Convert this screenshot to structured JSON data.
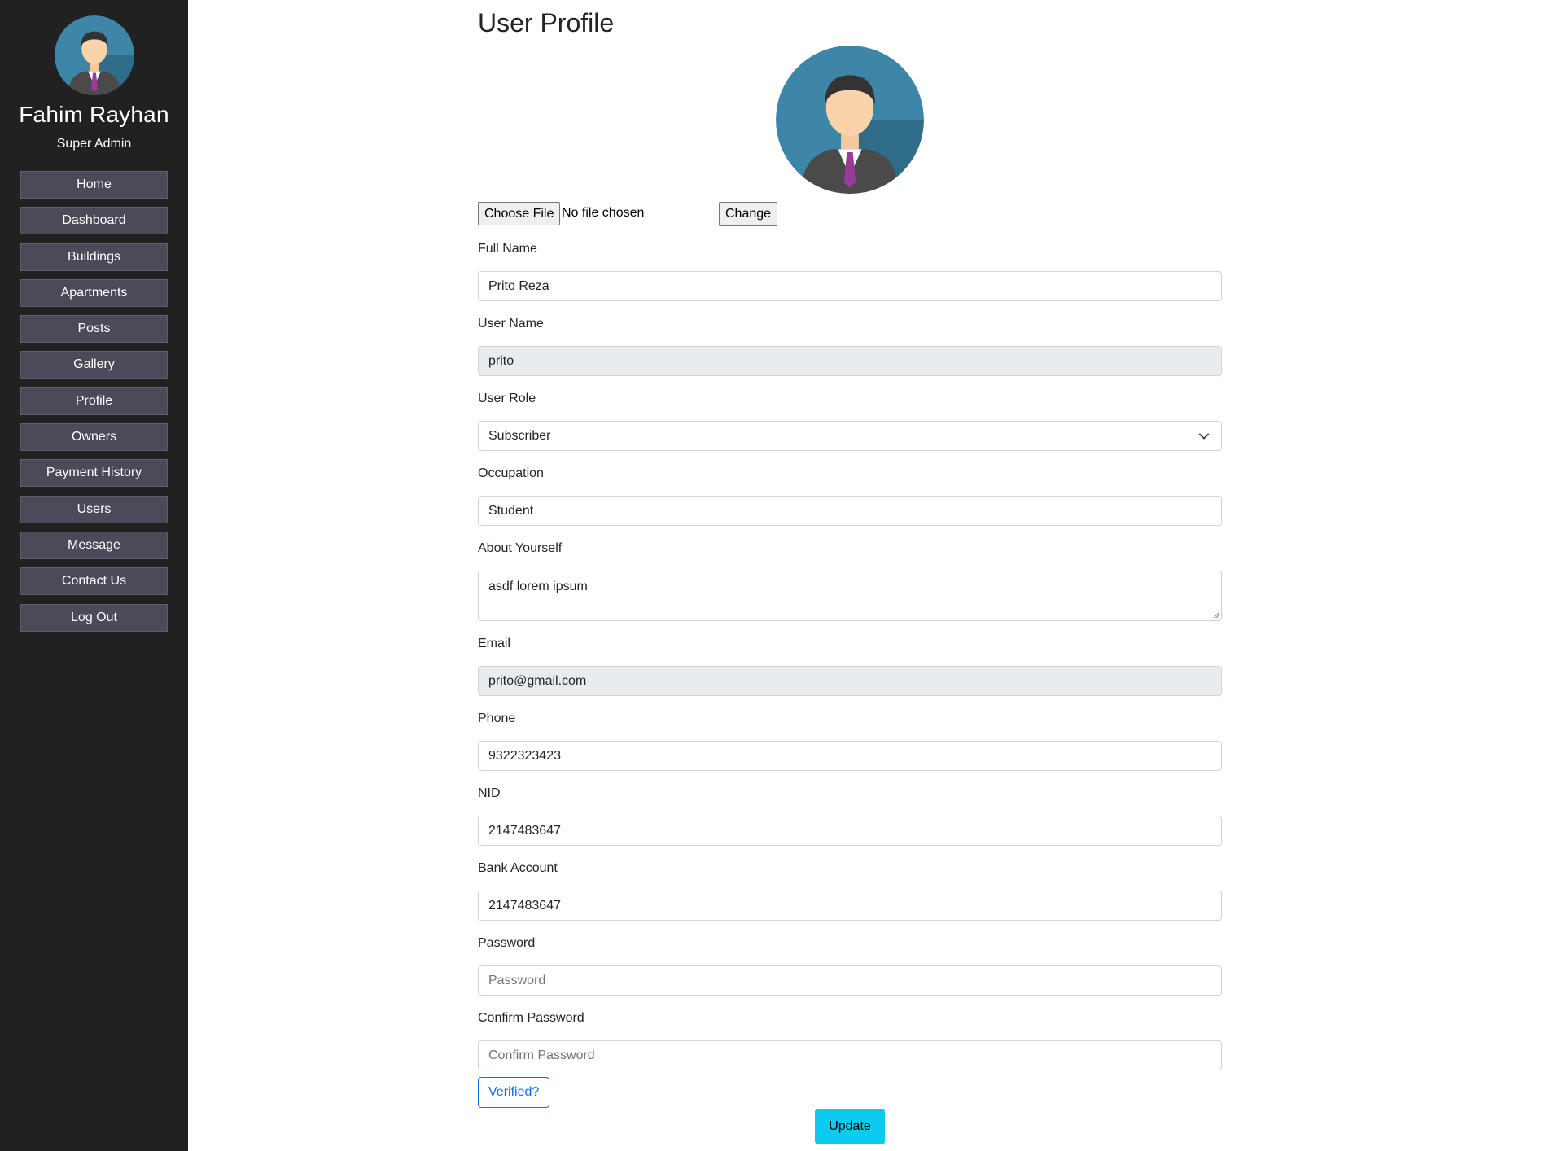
{
  "sidebar": {
    "user_name": "Fahim Rayhan",
    "user_role": "Super Admin",
    "items": [
      {
        "label": "Home"
      },
      {
        "label": "Dashboard"
      },
      {
        "label": "Buildings"
      },
      {
        "label": "Apartments"
      },
      {
        "label": "Posts"
      },
      {
        "label": "Gallery"
      },
      {
        "label": "Profile"
      },
      {
        "label": "Owners"
      },
      {
        "label": "Payment History"
      },
      {
        "label": "Users"
      },
      {
        "label": "Message"
      },
      {
        "label": "Contact Us"
      },
      {
        "label": "Log Out"
      }
    ]
  },
  "main": {
    "title": "User Profile",
    "file": {
      "choose_label": "Choose File",
      "status": "No file chosen",
      "change_label": "Change"
    },
    "fields": {
      "full_name": {
        "label": "Full Name",
        "value": "Prito Reza"
      },
      "user_name": {
        "label": "User Name",
        "value": "prito"
      },
      "user_role": {
        "label": "User Role",
        "value": "Subscriber"
      },
      "occupation": {
        "label": "Occupation",
        "value": "Student"
      },
      "about": {
        "label": "About Yourself",
        "value": "asdf lorem ipsum"
      },
      "email": {
        "label": "Email",
        "value": "prito@gmail.com"
      },
      "phone": {
        "label": "Phone",
        "value": "9322323423"
      },
      "nid": {
        "label": "NID",
        "value": "2147483647"
      },
      "bank": {
        "label": "Bank Account",
        "value": "2147483647"
      },
      "password": {
        "label": "Password",
        "placeholder": "Password"
      },
      "confirm_password": {
        "label": "Confirm Password",
        "placeholder": "Confirm Password"
      }
    },
    "verified_label": "Verified?",
    "update_label": "Update"
  },
  "colors": {
    "sidebar_bg": "#212121",
    "nav_button": "#4a4a58",
    "primary": "#0d6efd",
    "update_button": "#0dcaf0",
    "readonly_bg": "#e9ecef"
  },
  "icons": {
    "avatar": "businessman-avatar-icon",
    "select": "chevron-down-icon"
  }
}
